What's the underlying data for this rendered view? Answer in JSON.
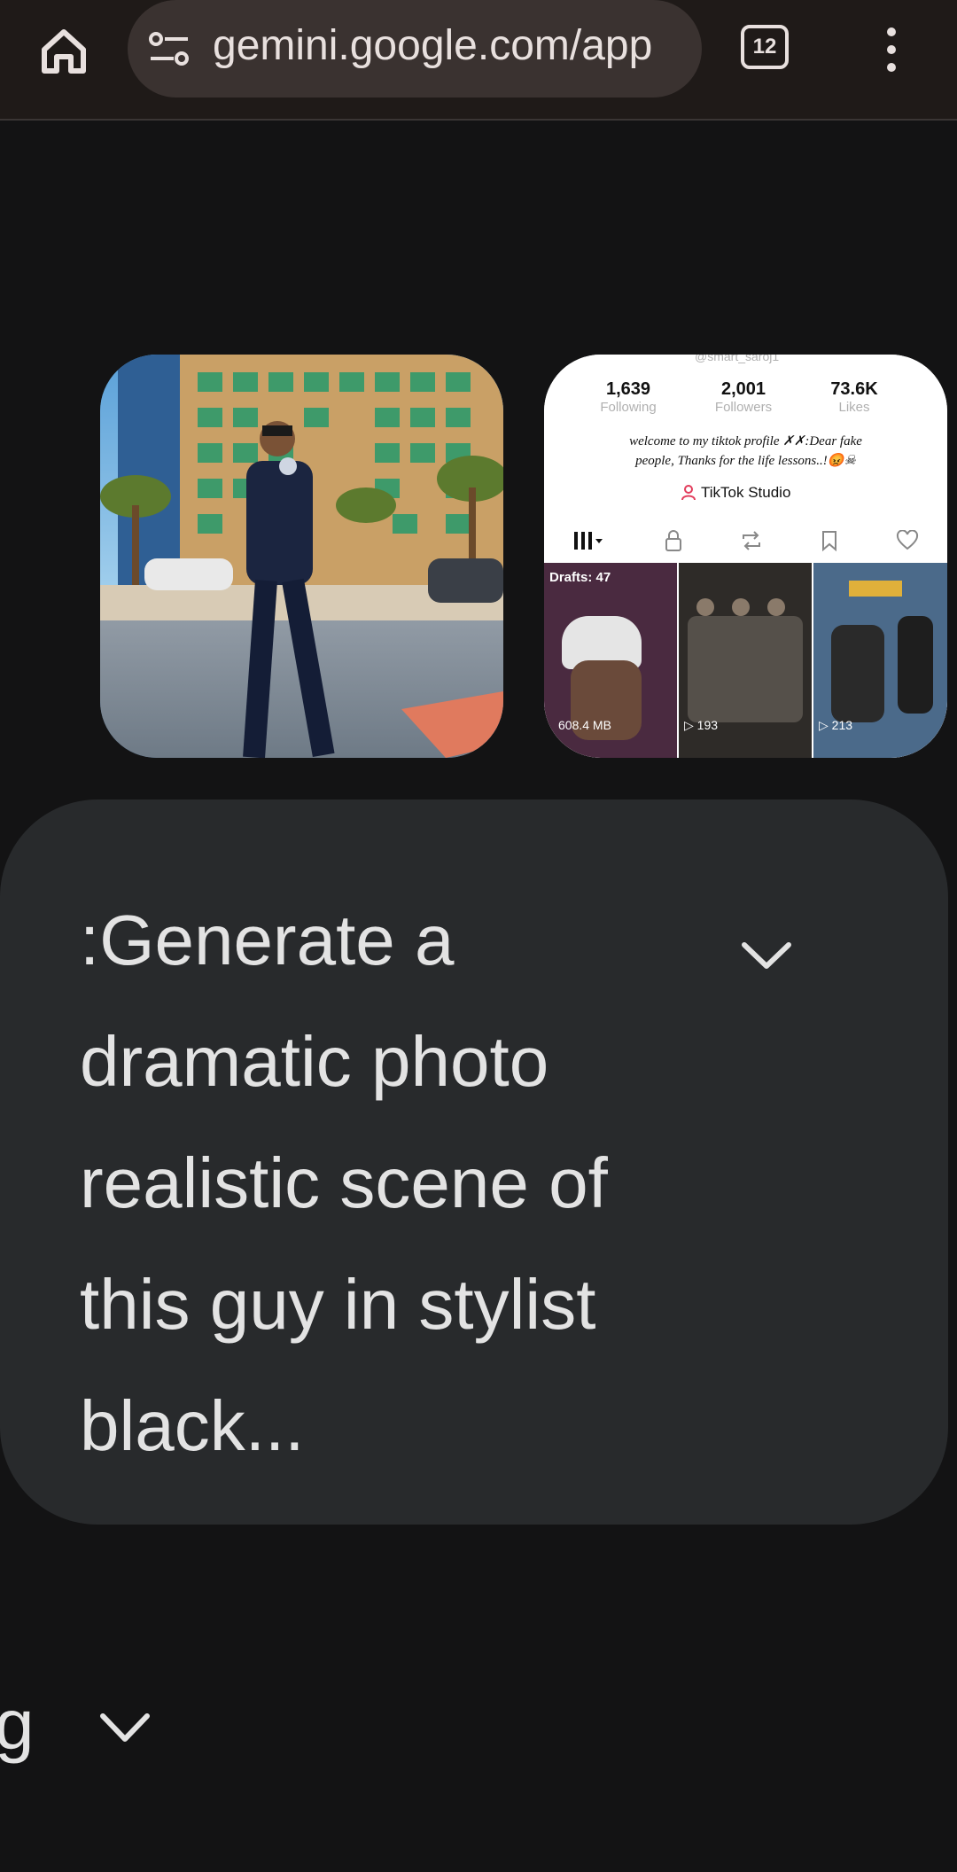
{
  "browser": {
    "url": "gemini.google.com/app",
    "tab_count": "12",
    "icons": [
      "home-icon",
      "site-settings-icon",
      "tab-switcher-icon",
      "more-vert-icon"
    ]
  },
  "attachments": [
    {
      "description_icon": "photo-thumbnail"
    },
    {
      "handle": "@smart_saroj1",
      "stats": [
        {
          "value": "1,639",
          "label": "Following"
        },
        {
          "value": "2,001",
          "label": "Followers"
        },
        {
          "value": "73.6K",
          "label": "Likes"
        }
      ],
      "bio_line1": "welcome to my tiktok profile ✗✗:Dear fake",
      "bio_line2": "people, Thanks for the life lessons..!😡☠",
      "studio_label": "TikTok Studio",
      "drafts": "Drafts: 47",
      "tile_counts": [
        "608.4 MB",
        "▷ 193",
        "▷ 213"
      ]
    }
  ],
  "prompt": {
    "text": ":Generate a dramatic photo realistic scene of this guy in stylist black..."
  },
  "partial_row": {
    "label": "g"
  }
}
